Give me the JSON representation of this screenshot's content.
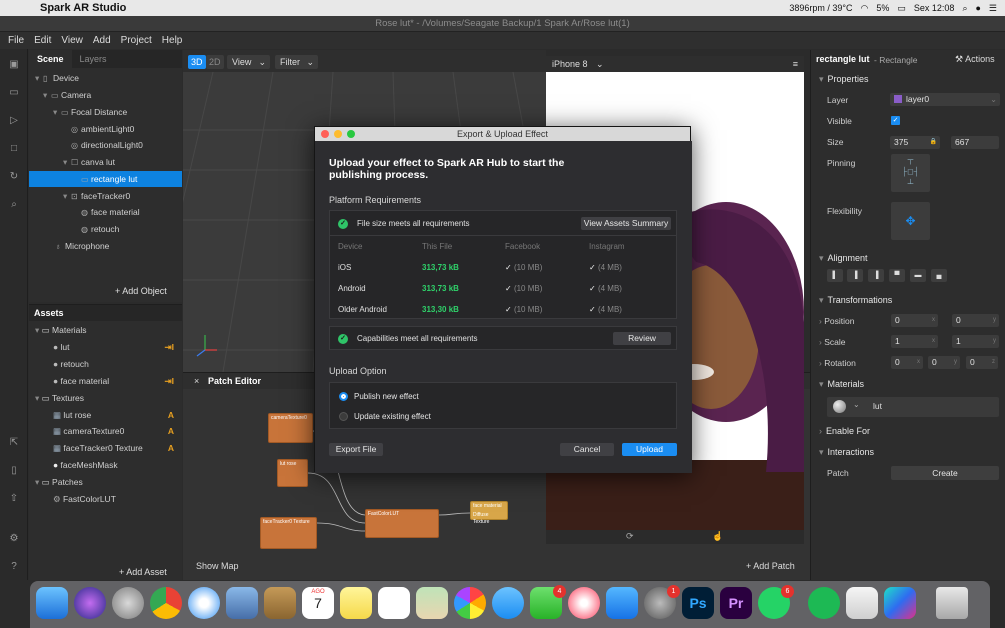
{
  "os": {
    "app_name": "Spark AR Studio",
    "status_fan": "3896rpm / 39°C",
    "battery": "5%",
    "clock": "Sex 12:08"
  },
  "window": {
    "title": "Rose lut* - /Volumes/Seagate Backup/1 Spark Ar/Rose lut(1)"
  },
  "menu": [
    "File",
    "Edit",
    "View",
    "Add",
    "Project",
    "Help"
  ],
  "scene_panel": {
    "tab_scene": "Scene",
    "tab_layers": "Layers",
    "tree": [
      {
        "label": "Device",
        "indent": 0,
        "selected": false
      },
      {
        "label": "Camera",
        "indent": 1,
        "selected": false
      },
      {
        "label": "Focal Distance",
        "indent": 2,
        "selected": false
      },
      {
        "label": "ambientLight0",
        "indent": 3,
        "selected": false
      },
      {
        "label": "directionalLight0",
        "indent": 3,
        "selected": false
      },
      {
        "label": "canva lut",
        "indent": 3,
        "selected": false
      },
      {
        "label": "rectangle lut",
        "indent": 4,
        "selected": true
      },
      {
        "label": "faceTracker0",
        "indent": 3,
        "selected": false
      },
      {
        "label": "face material",
        "indent": 4,
        "selected": false
      },
      {
        "label": "retouch",
        "indent": 4,
        "selected": false
      },
      {
        "label": "Microphone",
        "indent": 1,
        "selected": false
      }
    ],
    "add_object": "+ Add Object"
  },
  "assets_panel": {
    "header": "Assets",
    "items": [
      {
        "label": "Materials",
        "indent": 0,
        "tag": ""
      },
      {
        "label": "lut",
        "indent": 1,
        "tag": "⇥I"
      },
      {
        "label": "retouch",
        "indent": 1,
        "tag": ""
      },
      {
        "label": "face material",
        "indent": 1,
        "tag": "⇥I"
      },
      {
        "label": "Textures",
        "indent": 0,
        "tag": ""
      },
      {
        "label": "lut rose",
        "indent": 1,
        "tag": "A"
      },
      {
        "label": "cameraTexture0",
        "indent": 1,
        "tag": "A"
      },
      {
        "label": "faceTracker0 Texture",
        "indent": 1,
        "tag": "A"
      },
      {
        "label": "faceMeshMask",
        "indent": 1,
        "tag": ""
      },
      {
        "label": "Patches",
        "indent": 0,
        "tag": ""
      },
      {
        "label": "FastColorLUT",
        "indent": 1,
        "tag": ""
      }
    ],
    "add_asset": "+ Add Asset"
  },
  "viewport": {
    "mode_3d": "3D",
    "mode_2d": "2D",
    "view_label": "View",
    "filter_label": "Filter"
  },
  "device": {
    "name": "iPhone 8"
  },
  "patch_editor": {
    "title": "Patch Editor",
    "show_map": "Show Map",
    "add_patch": "+ Add Patch",
    "nodes": [
      "cameraTexture0",
      "lut rose",
      "faceTracker0 Texture",
      "FastColorLUT",
      "face material",
      "Diffuse Texture"
    ]
  },
  "inspector": {
    "object_name": "rectangle lut",
    "object_type": "- Rectangle",
    "actions": "Actions",
    "properties": "Properties",
    "layer_label": "Layer",
    "layer_value": "layer0",
    "visible_label": "Visible",
    "size_label": "Size",
    "size_w": "375",
    "size_h": "667",
    "pinning_label": "Pinning",
    "flexibility_label": "Flexibility",
    "alignment": "Alignment",
    "transformations": "Transformations",
    "position_label": "Position",
    "pos_x": "0",
    "pos_y": "0",
    "scale_label": "Scale",
    "scale_x": "1",
    "scale_y": "1",
    "rotation_label": "Rotation",
    "rot_x": "0",
    "rot_y": "0",
    "rot_z": "0",
    "materials": "Materials",
    "material_value": "lut",
    "enable_for": "Enable For",
    "interactions": "Interactions",
    "patch_label": "Patch",
    "create": "Create"
  },
  "modal": {
    "title": "Export & Upload Effect",
    "heading": "Upload your effect to Spark AR Hub to start the publishing process.",
    "platform_requirements": "Platform Requirements",
    "file_size_ok": "File size meets all requirements",
    "view_assets": "View Assets Summary",
    "columns": [
      "Device",
      "This File",
      "Facebook",
      "Instagram"
    ],
    "rows": [
      {
        "device": "iOS",
        "file": "313,73 kB",
        "facebook": "(10 MB)",
        "instagram": "(4 MB)"
      },
      {
        "device": "Android",
        "file": "313,73 kB",
        "facebook": "(10 MB)",
        "instagram": "(4 MB)"
      },
      {
        "device": "Older Android",
        "file": "313,30 kB",
        "facebook": "(10 MB)",
        "instagram": "(4 MB)"
      }
    ],
    "capabilities_ok": "Capabilities meet all requirements",
    "review": "Review",
    "upload_option": "Upload Option",
    "opt_publish": "Publish new effect",
    "opt_update": "Update existing effect",
    "export_file": "Export File",
    "cancel": "Cancel",
    "upload": "Upload"
  },
  "dock": {
    "calendar_month": "AGO",
    "calendar_day": "7",
    "badges": {
      "facetime": "4",
      "sysprefs": "1",
      "whatsapp": "6"
    },
    "ps": "Ps",
    "pr": "Pr"
  },
  "colors": {
    "accent": "#1a8df2",
    "selection": "#0d82e0",
    "ok_green": "#2fc468",
    "patch_node": "#c8743a"
  }
}
